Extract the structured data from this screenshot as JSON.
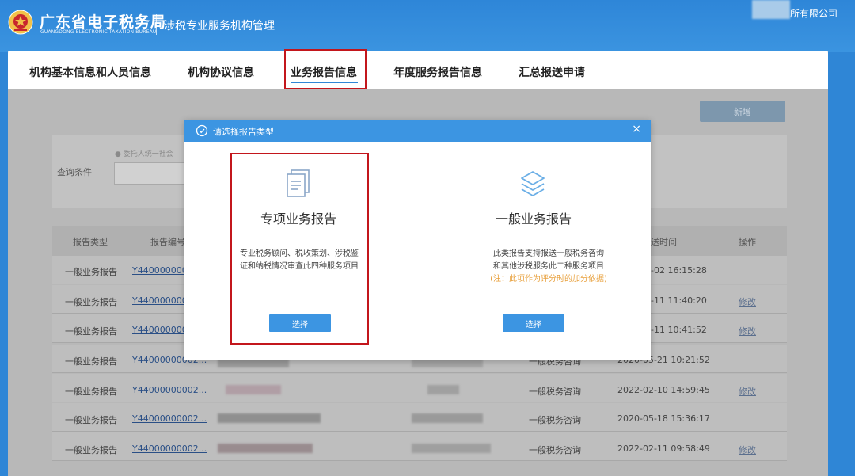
{
  "header": {
    "title": "广东省电子税务局",
    "subtitle": "GUANGDONG ELECTRONIC TAXATION BUREAU",
    "system_name": "涉税专业服务机构管理",
    "company": "所有限公司"
  },
  "tabs": [
    {
      "label": "机构基本信息和人员信息"
    },
    {
      "label": "机构协议信息"
    },
    {
      "label": "业务报告信息",
      "active": true
    },
    {
      "label": "年度服务报告信息"
    },
    {
      "label": "汇总报送申请"
    }
  ],
  "toolbar": {
    "add_label": "新增"
  },
  "query": {
    "label": "查询条件",
    "hint": "● 委托人统一社会"
  },
  "table": {
    "headers": [
      "报告类型",
      "报告编号",
      "送时间",
      "操作"
    ],
    "rows": [
      {
        "type": "一般业务报告",
        "code": "Y440000000",
        "service": "",
        "time": "-02 16:15:28",
        "action": ""
      },
      {
        "type": "一般业务报告",
        "code": "Y440000000",
        "service": "",
        "time": "-11 11:40:20",
        "action": "修改"
      },
      {
        "type": "一般业务报告",
        "code": "Y440000000",
        "service": "",
        "time": "-11 10:41:52",
        "action": "修改"
      },
      {
        "type": "一般业务报告",
        "code": "Y44000000002...",
        "service": "一般税务咨询",
        "time": "2020-05-21 10:21:52",
        "action": ""
      },
      {
        "type": "一般业务报告",
        "code": "Y44000000002...",
        "service": "一般税务咨询",
        "time": "2022-02-10 14:59:45",
        "action": "修改"
      },
      {
        "type": "一般业务报告",
        "code": "Y44000000002...",
        "service": "一般税务咨询",
        "time": "2020-05-18 15:36:17",
        "action": ""
      },
      {
        "type": "一般业务报告",
        "code": "Y44000000002...",
        "service": "一般税务咨询",
        "time": "2022-02-11 09:58:49",
        "action": "修改"
      }
    ]
  },
  "modal": {
    "title": "请选择报告类型",
    "close": "×",
    "special": {
      "title": "专项业务报告",
      "desc": "专业税务顾问、税收策划、涉税鉴证和纳税情况审查此四种服务项目",
      "button": "选择"
    },
    "general": {
      "title": "一般业务报告",
      "desc_line1": "此类报告支持报送一般税务咨询",
      "desc_line2": "和其他涉税服务此二种服务项目",
      "note": "(注：此项作为评分时的加分依据)",
      "button": "选择"
    }
  },
  "colors": {
    "brand_blue": "#2f86d6",
    "modal_blue": "#3c95e2",
    "highlight_red": "#c3161c",
    "note_orange": "#e8a03c"
  }
}
